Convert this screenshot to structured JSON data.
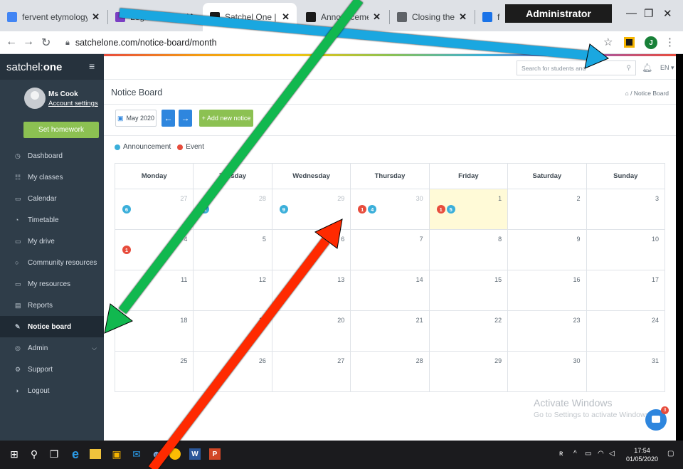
{
  "browser": {
    "tabs": [
      {
        "label": "fervent etymology - Go",
        "icon": "google-g",
        "color": "#4285f4"
      },
      {
        "label": "Logins & Resources —",
        "icon": "bookmark",
        "color": "#7b3fc4"
      },
      {
        "label": "Satchel One | Learning",
        "icon": "satchel-s",
        "color": "#1a1a1a",
        "active": true
      },
      {
        "label": "Announcements & Eve",
        "icon": "satchel-s",
        "color": "#1a1a1a"
      },
      {
        "label": "Closing the Gap Resour",
        "icon": "globe",
        "color": "#5f6368"
      },
      {
        "label": "ferve",
        "icon": "s-circle",
        "color": "#1a73e8"
      }
    ],
    "admin_badge": "Administrator",
    "url": "satchelone.com/notice-board/month",
    "profile_initial": "J"
  },
  "sidebar": {
    "brand_light": "satchel:",
    "brand_bold": "one",
    "user_name": "Ms Cook",
    "account_link": "Account settings",
    "set_homework": "Set homework",
    "items": [
      {
        "label": "Dashboard",
        "icon": "◷"
      },
      {
        "label": "My classes",
        "icon": "☷"
      },
      {
        "label": "Calendar",
        "icon": "▭"
      },
      {
        "label": "Timetable",
        "icon": "◔"
      },
      {
        "label": "My drive",
        "icon": "▭"
      },
      {
        "label": "Community resources",
        "icon": "○"
      },
      {
        "label": "My resources",
        "icon": "▭"
      },
      {
        "label": "Reports",
        "icon": "▤"
      },
      {
        "label": "Notice board",
        "icon": "✎",
        "active": true
      },
      {
        "label": "Admin",
        "icon": "◎",
        "chevron": "⌵"
      },
      {
        "label": "Support",
        "icon": "⚙"
      },
      {
        "label": "Logout",
        "icon": "◑"
      }
    ]
  },
  "topbar": {
    "search_placeholder": "Search for students and",
    "language": "EN ▾"
  },
  "page": {
    "title": "Notice Board",
    "breadcrumb": "⌂ / Notice Board",
    "month_button": "May 2020",
    "prev": "←",
    "next": "→",
    "add_notice": "+ Add new notice",
    "legend_announcement": "Announcement",
    "legend_event": "Event"
  },
  "calendar": {
    "weekdays": [
      "Monday",
      "Tuesday",
      "Wednesday",
      "Thursday",
      "Friday",
      "Saturday",
      "Sunday"
    ],
    "weeks": [
      [
        {
          "day": "27",
          "muted": true,
          "badges": [
            {
              "type": "announcement",
              "count": "6"
            }
          ]
        },
        {
          "day": "28",
          "muted": true,
          "badges": [
            {
              "type": "announcement",
              "count": "1"
            }
          ]
        },
        {
          "day": "29",
          "muted": true,
          "badges": [
            {
              "type": "announcement",
              "count": "9"
            }
          ]
        },
        {
          "day": "30",
          "muted": true,
          "badges": [
            {
              "type": "event",
              "count": "1"
            },
            {
              "type": "announcement",
              "count": "4"
            }
          ]
        },
        {
          "day": "1",
          "today": true,
          "badges": [
            {
              "type": "event",
              "count": "1"
            },
            {
              "type": "announcement",
              "count": "5"
            }
          ]
        },
        {
          "day": "2"
        },
        {
          "day": "3"
        }
      ],
      [
        {
          "day": "4",
          "badges": [
            {
              "type": "event",
              "count": "1"
            }
          ]
        },
        {
          "day": "5"
        },
        {
          "day": "6"
        },
        {
          "day": "7"
        },
        {
          "day": "8"
        },
        {
          "day": "9"
        },
        {
          "day": "10"
        }
      ],
      [
        {
          "day": "11"
        },
        {
          "day": "12"
        },
        {
          "day": "13"
        },
        {
          "day": "14"
        },
        {
          "day": "15"
        },
        {
          "day": "16"
        },
        {
          "day": "17"
        }
      ],
      [
        {
          "day": "18"
        },
        {
          "day": "19"
        },
        {
          "day": "20"
        },
        {
          "day": "21"
        },
        {
          "day": "22"
        },
        {
          "day": "23"
        },
        {
          "day": "24"
        }
      ],
      [
        {
          "day": "25"
        },
        {
          "day": "26"
        },
        {
          "day": "27"
        },
        {
          "day": "28"
        },
        {
          "day": "29"
        },
        {
          "day": "30"
        },
        {
          "day": "31"
        }
      ]
    ]
  },
  "watermark": {
    "line1": "Activate Windows",
    "line2": "Go to Settings to activate Windows."
  },
  "chat_badge": "3",
  "taskbar": {
    "time": "17:54",
    "date": "01/05/2020"
  },
  "colors": {
    "arrow_blue": "#1aa7e0",
    "arrow_green": "#11b84f",
    "arrow_red": "#ff2a00"
  }
}
